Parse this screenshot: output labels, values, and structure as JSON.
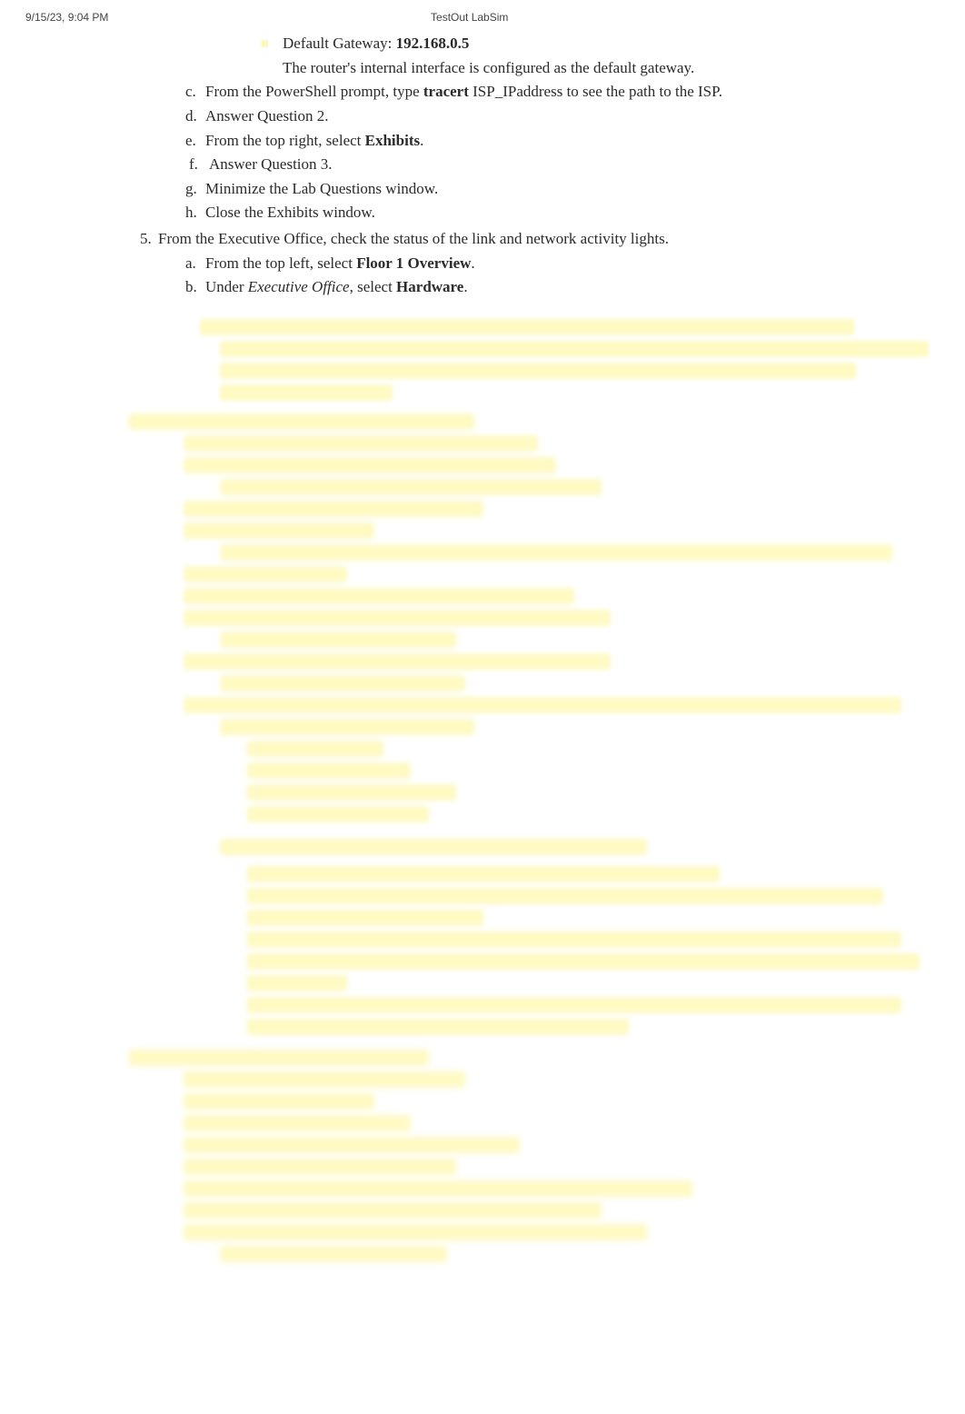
{
  "header": {
    "left": "9/15/23, 9:04 PM",
    "center": "TestOut LabSim"
  },
  "gateway": {
    "lead": "Default Gateway: ",
    "value": "192.168.0.5",
    "note": "The router's internal interface is configured as the default gateway."
  },
  "tracert_line": {
    "letter": "c.",
    "prefix": "From the PowerShell prompt, type ",
    "cmd_bold": "tracert",
    "arg": " ISP_IPaddress",
    "suffix": "  to see the path to the ISP."
  },
  "items_dh": [
    {
      "letter": "d.",
      "text": "Answer Question 2."
    },
    {
      "letter": "e.",
      "text_pre": "From the top right, select ",
      "bold": "Exhibits",
      "text_post": "."
    },
    {
      "letter": "f.",
      "text": "Answer Question 3."
    },
    {
      "letter": "g.",
      "text": "Minimize the Lab Questions window."
    },
    {
      "letter": "h.",
      "text": "Close the Exhibits window."
    }
  ],
  "step5": {
    "num": "5.",
    "text": "From the Executive Office, check the status of the link and network activity lights."
  },
  "step5_sub": [
    {
      "letter": "a.",
      "pre": "From the top left, select ",
      "bold": "Floor 1 Overview",
      "post": "."
    },
    {
      "letter": "b.",
      "pre": "Under ",
      "ital": "Executive Office",
      "mid": ", select ",
      "bold": "Hardware",
      "post": "."
    }
  ]
}
